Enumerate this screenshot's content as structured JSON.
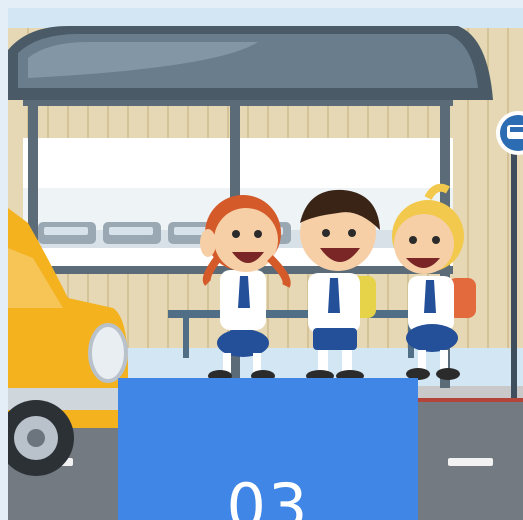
{
  "illustration": {
    "subject": "children-at-bus-stop",
    "sign_icon": "bus-icon"
  },
  "badge": {
    "text": "03",
    "color": "#3f86e6"
  }
}
